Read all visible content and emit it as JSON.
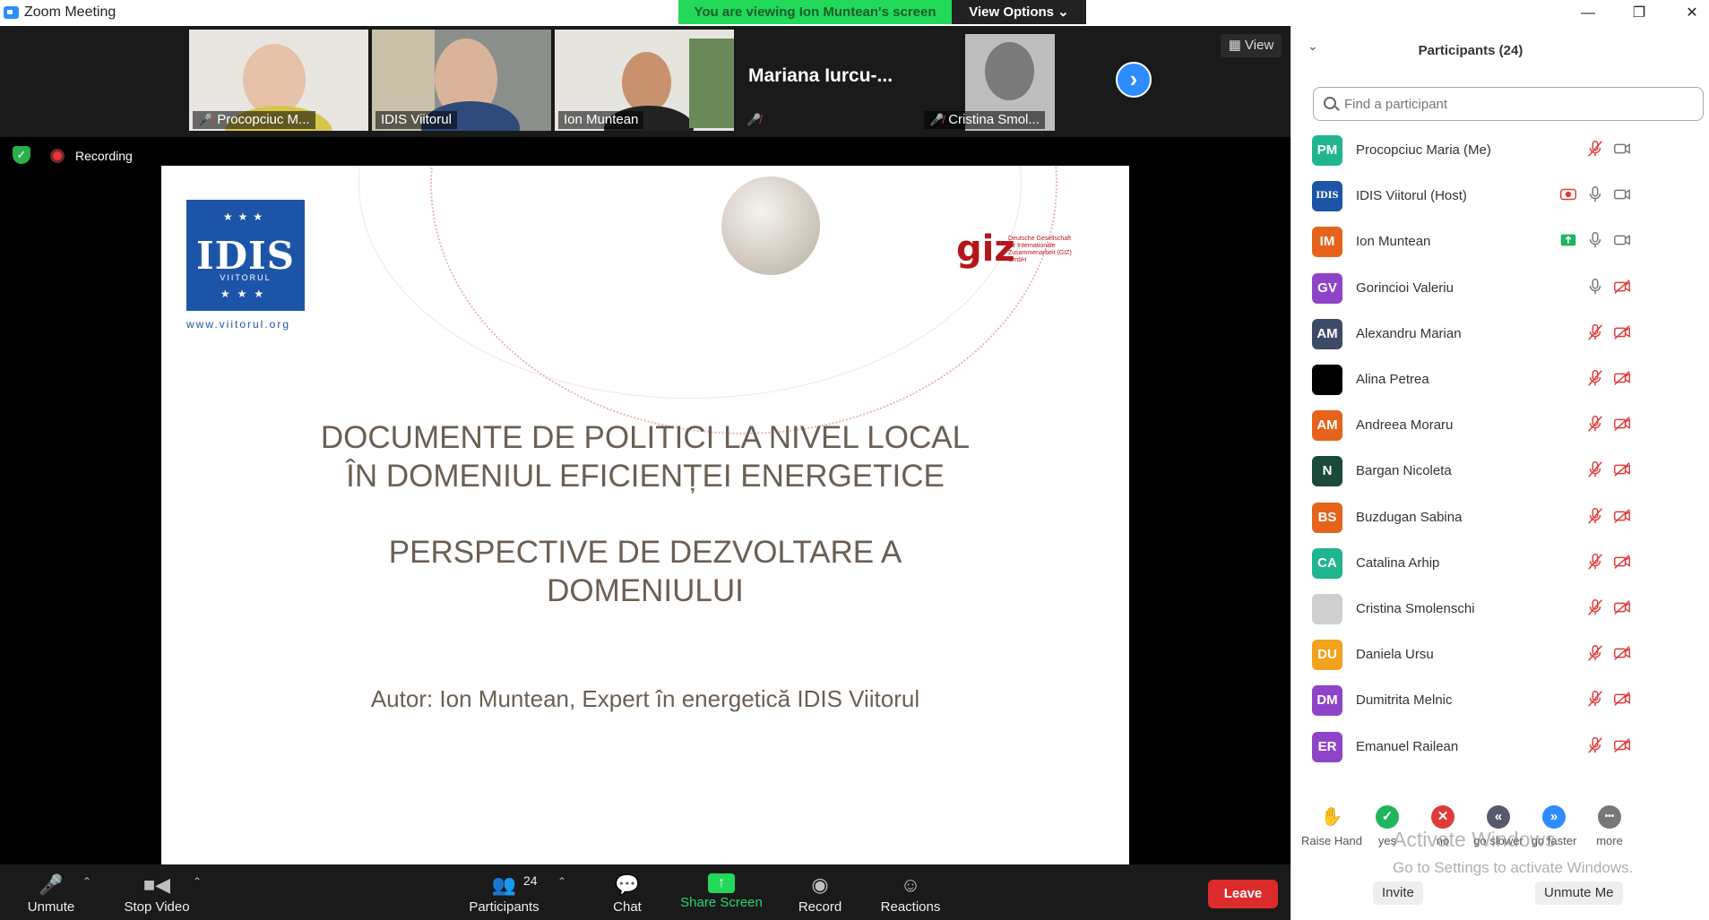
{
  "window": {
    "title": "Zoom Meeting",
    "banner": "You are viewing Ion Muntean's screen",
    "view_options": "View Options",
    "view_options_caret": "⌄",
    "minimize": "—",
    "restore": "❐",
    "close": "✕"
  },
  "strip": {
    "tiles": [
      {
        "name": "Procopciuc M..."
      },
      {
        "name": "IDIS Viitorul"
      },
      {
        "name": "Ion Muntean"
      },
      {
        "name": "Mariana Iurcu-..."
      },
      {
        "name": "Cristina Smol..."
      }
    ],
    "next": "›",
    "view": "View",
    "recording": "Recording"
  },
  "slide": {
    "idis_name": "IDIS",
    "idis_sub": "VIITORUL",
    "idis_url": "www.viitorul.org",
    "giz": "giz",
    "giz_sub": "Deutsche Gesellschaft für Internationale Zusammenarbeit (GIZ) GmbH",
    "title_line1": "DOCUMENTE DE POLITICI LA NIVEL LOCAL",
    "title_line2": "ÎN DOMENIUL EFICIENȚEI ENERGETICE",
    "subtitle_line1": "PERSPECTIVE DE DEZVOLTARE A",
    "subtitle_line2": "DOMENIULUI",
    "author": "Autor: Ion Muntean, Expert în energetică IDIS Viitorul"
  },
  "toolbar": {
    "unmute": "Unmute",
    "stop_video": "Stop Video",
    "participants": "Participants",
    "participants_count": "24",
    "chat": "Chat",
    "share_screen": "Share Screen",
    "record": "Record",
    "reactions": "Reactions",
    "leave": "Leave"
  },
  "panel": {
    "title": "Participants (24)",
    "search_placeholder": "Find a participant",
    "participants": [
      {
        "initials": "PM",
        "color": "#1fb58f",
        "name": "Procopciuc Maria (Me)",
        "mic": "muted",
        "cam": "on"
      },
      {
        "initials": "IDIS",
        "color": "#1c55a8",
        "name": "IDIS Viitorul (Host)",
        "mic": "on",
        "cam": "on",
        "extra": "recording"
      },
      {
        "initials": "IM",
        "color": "#e5631b",
        "name": "Ion Muntean",
        "mic": "on",
        "cam": "on",
        "extra": "sharing"
      },
      {
        "initials": "GV",
        "color": "#8e44c9",
        "name": "Gorincioi Valeriu",
        "mic": "on",
        "cam": "off"
      },
      {
        "initials": "AM",
        "color": "#3d4b66",
        "name": "Alexandru Marian",
        "mic": "muted",
        "cam": "off"
      },
      {
        "initials": "",
        "color": "#000000",
        "name": "Alina Petrea",
        "mic": "muted",
        "cam": "off"
      },
      {
        "initials": "AM",
        "color": "#e5631b",
        "name": "Andreea Moraru",
        "mic": "muted",
        "cam": "off"
      },
      {
        "initials": "N",
        "color": "#1b4a3a",
        "name": "Bargan Nicoleta",
        "mic": "muted",
        "cam": "off"
      },
      {
        "initials": "BS",
        "color": "#e5631b",
        "name": "Buzdugan Sabina",
        "mic": "muted",
        "cam": "off"
      },
      {
        "initials": "CA",
        "color": "#1fb58f",
        "name": "Catalina Arhip",
        "mic": "muted",
        "cam": "off"
      },
      {
        "initials": "",
        "color": "#cfcfcf",
        "name": "Cristina Smolenschi",
        "mic": "muted",
        "cam": "off"
      },
      {
        "initials": "DU",
        "color": "#f2a21b",
        "name": "Daniela Ursu",
        "mic": "muted",
        "cam": "off"
      },
      {
        "initials": "DM",
        "color": "#8e44c9",
        "name": "Dumitrita Melnic",
        "mic": "muted",
        "cam": "off"
      },
      {
        "initials": "ER",
        "color": "#8e44c9",
        "name": "Emanuel Railean",
        "mic": "muted",
        "cam": "off"
      }
    ],
    "reactions": [
      {
        "label": "Raise Hand",
        "glyph": "✋",
        "color": "transparent"
      },
      {
        "label": "yes",
        "glyph": "✓",
        "color": "#1fb55a"
      },
      {
        "label": "no",
        "glyph": "✕",
        "color": "#e03b3b"
      },
      {
        "label": "go slower",
        "glyph": "«",
        "color": "#555b6b"
      },
      {
        "label": "go faster",
        "glyph": "»",
        "color": "#2d8cff"
      },
      {
        "label": "more",
        "glyph": "•••",
        "color": "#777"
      }
    ],
    "watermark_title": "Activate Windows",
    "watermark_sub": "Go to Settings to activate Windows.",
    "invite": "Invite",
    "unmute_me": "Unmute Me"
  }
}
